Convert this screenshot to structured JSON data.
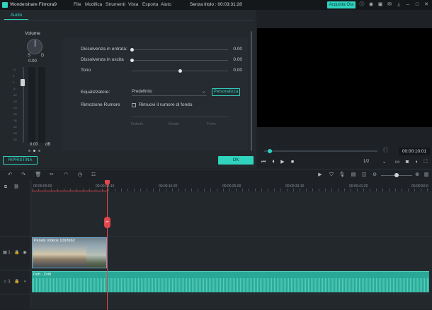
{
  "app": {
    "name": "Wondershare Filmora9",
    "document_title": "Senza titolo : 00:03:31:28",
    "buy_label": "Acquista Ora",
    "menu": [
      "File",
      "Modifica",
      "Strumenti",
      "Vista",
      "Esporta",
      "Aiuto"
    ]
  },
  "audio_panel": {
    "tab_label": "Audio",
    "volume": {
      "label": "Volume",
      "left_label": "S",
      "right_label": "D",
      "value": "0.00",
      "bottom_value": "0.00",
      "unit": "dB",
      "scale": [
        "12",
        "6",
        "0",
        "-6",
        "-12",
        "-18",
        "-24",
        "-30",
        "-36",
        "-42",
        "-48",
        "-54"
      ]
    },
    "fade_in": {
      "label": "Dissolvenza in entrata:",
      "value": "0.00",
      "fraction": 0.0
    },
    "fade_out": {
      "label": "Dissolvenza in uscita",
      "value": "0.00",
      "fraction": 0.0
    },
    "pitch": {
      "label": "Tono",
      "value": "0.00",
      "fraction": 0.5
    },
    "equalizer": {
      "label": "Equalizzatore:",
      "selected": "Predefinito",
      "custom_label": "Personalizza"
    },
    "noise": {
      "label": "Rimozione Rumore",
      "checkbox_label": "Rimuovi il rumore di fondo",
      "checked": false,
      "levels": [
        "Debole",
        "Medio",
        "Forte"
      ]
    },
    "reset_label": "RIPRISTINA",
    "ok_label": "OK"
  },
  "preview": {
    "time": "00:00:10:01",
    "ratio": "1/2",
    "progress_fraction": 0.03
  },
  "timeline": {
    "ruler": [
      "00:00:00:00",
      "00:00:08:10",
      "00:00:16:20",
      "00:00:25:00",
      "00:00:33:10",
      "00:00:41:20",
      "00:00:50:0"
    ],
    "video_track": {
      "number": "1",
      "clip_label": "Pexels Videos 1093662"
    },
    "audio_track": {
      "number": "1",
      "clip_label": "Drift - Drift"
    }
  },
  "colors": {
    "accent": "#2fd3be",
    "playhead": "#e0474c"
  }
}
